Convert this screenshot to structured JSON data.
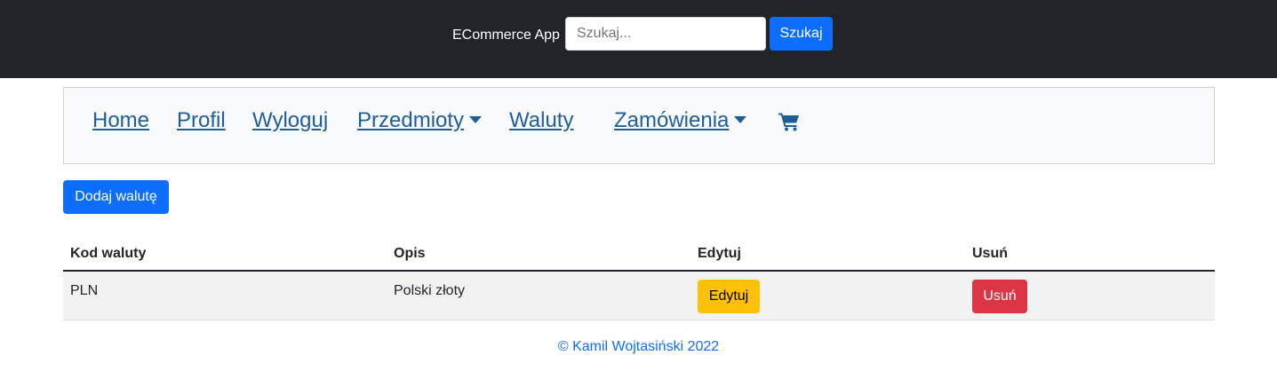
{
  "header": {
    "brand": "ECommerce App",
    "search_placeholder": "Szukaj...",
    "search_button": "Szukaj"
  },
  "nav": {
    "home": "Home",
    "profile": "Profil",
    "logout": "Wyloguj",
    "items": "Przedmioty",
    "currencies": "Waluty",
    "orders": "Zamówienia",
    "cart_icon": "shopping-cart-icon"
  },
  "main": {
    "add_button": "Dodaj walutę",
    "table": {
      "headers": [
        "Kod waluty",
        "Opis",
        "Edytuj",
        "Usuń"
      ],
      "rows": [
        {
          "code": "PLN",
          "description": "Polski złoty",
          "edit": "Edytuj",
          "delete": "Usuń"
        }
      ]
    }
  },
  "footer": {
    "text": "© Kamil Wojtasiński 2022"
  },
  "colors": {
    "topbar": "#212529",
    "primary": "#0d6efd",
    "warning": "#ffc107",
    "danger": "#dc3545",
    "nav_link": "#1f5e99"
  }
}
